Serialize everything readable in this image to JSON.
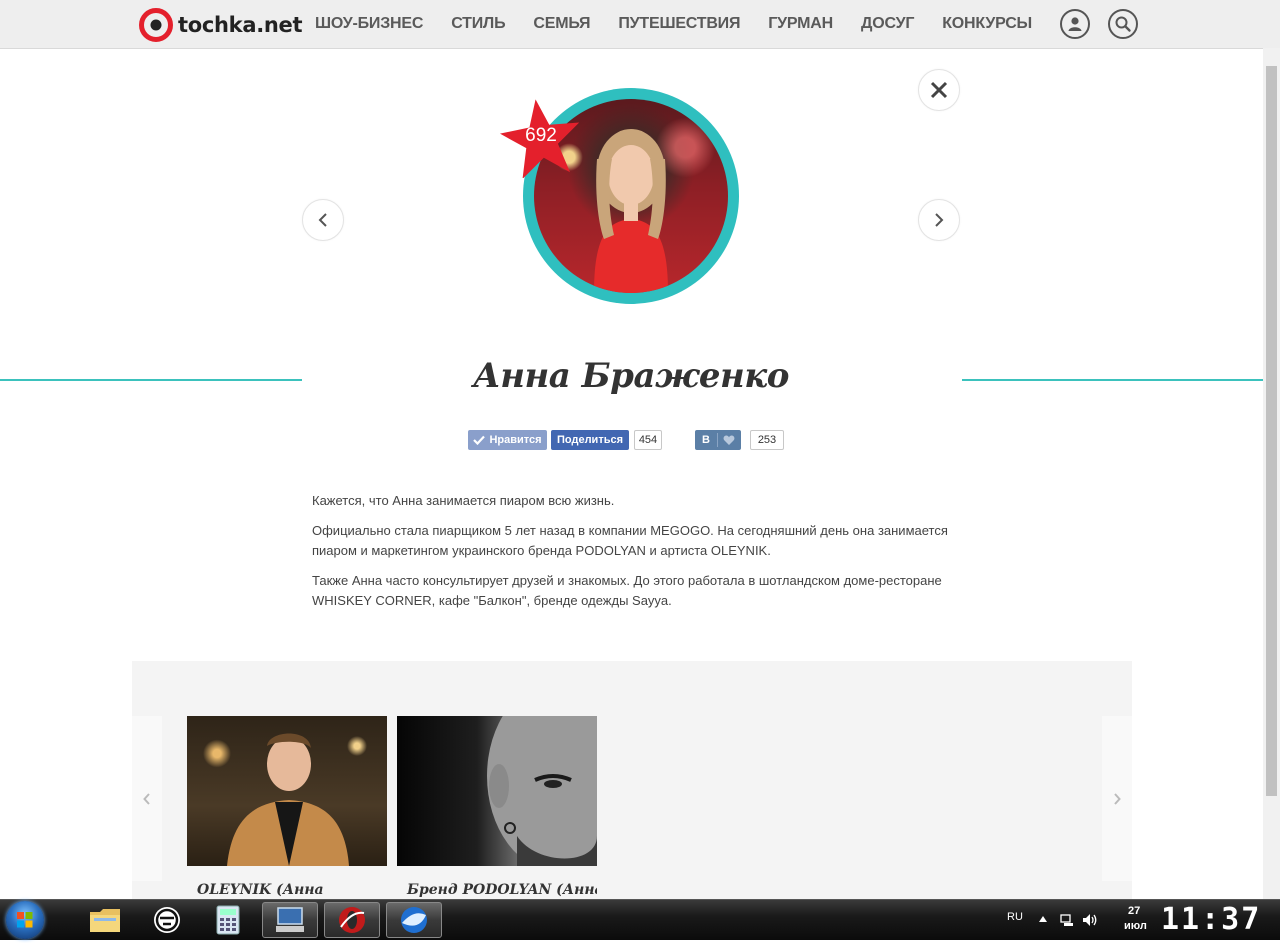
{
  "header": {
    "logo_text": "tochka.net",
    "nav": [
      "ШОУ-БИЗНЕС",
      "СТИЛЬ",
      "СЕМЬЯ",
      "ПУТЕШЕСТВИЯ",
      "ГУРМАН",
      "ДОСУГ",
      "КОНКУРСЫ"
    ],
    "icons": [
      "user-icon",
      "search-icon"
    ]
  },
  "profile": {
    "rank": "692",
    "name": "Анна Браженко",
    "accent_color": "#3bc2bd",
    "badge_color": "#e4202c"
  },
  "social": {
    "fb_like_label": "Нравится",
    "fb_share_label": "Поделиться",
    "fb_count": "454",
    "vk_label": "В",
    "vk_count": "253"
  },
  "bio": [
    "Кажется, что Анна занимается пиаром всю жизнь.",
    "Официально стала пиарщиком 5 лет назад в компании MEGOGO. На сегодняшний день она занимается пиаром и маркетингом украинского бренда PODOLYAN и артиста OLEYNIK.",
    "Также Анна часто консультирует друзей и знакомых. До этого работала в шотландском доме-ресторане WHISKEY CORNER, кафе \"Балкон\", бренде одежды Sayya."
  ],
  "related": [
    {
      "title": "OLEYNIK (Анна"
    },
    {
      "title": "Бренд PODOLYAN (Анна"
    }
  ],
  "taskbar": {
    "lang": "RU",
    "date_day": "27",
    "date_month": "июл",
    "time": "11:37"
  }
}
